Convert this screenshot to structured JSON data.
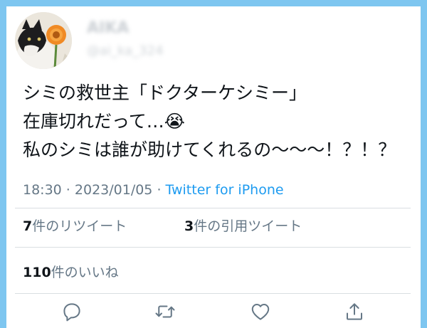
{
  "user": {
    "display_name": "AIKA",
    "handle": "@ai_ka_324"
  },
  "tweet": {
    "lines": [
      "シミの救世主「ドクターケシミー」",
      "在庫切れだって…😭",
      "私のシミは誰が助けてくれるの〜〜〜！？！？"
    ],
    "time": "18:30",
    "date": "2023/01/05",
    "separator": " · ",
    "source": "Twitter for iPhone"
  },
  "stats": {
    "retweets_count": "7",
    "retweets_label": "件のリツイート",
    "quotes_count": "3",
    "quotes_label": "件の引用ツイート",
    "likes_count": "110",
    "likes_label": "件のいいね"
  },
  "actions": [
    {
      "icon": "reply-icon"
    },
    {
      "icon": "retweet-icon"
    },
    {
      "icon": "like-icon"
    },
    {
      "icon": "share-icon"
    }
  ],
  "colors": {
    "background": "#7ec6f0",
    "accent": "#1d9bf0",
    "text": "#0f1419",
    "secondary": "#657786"
  }
}
